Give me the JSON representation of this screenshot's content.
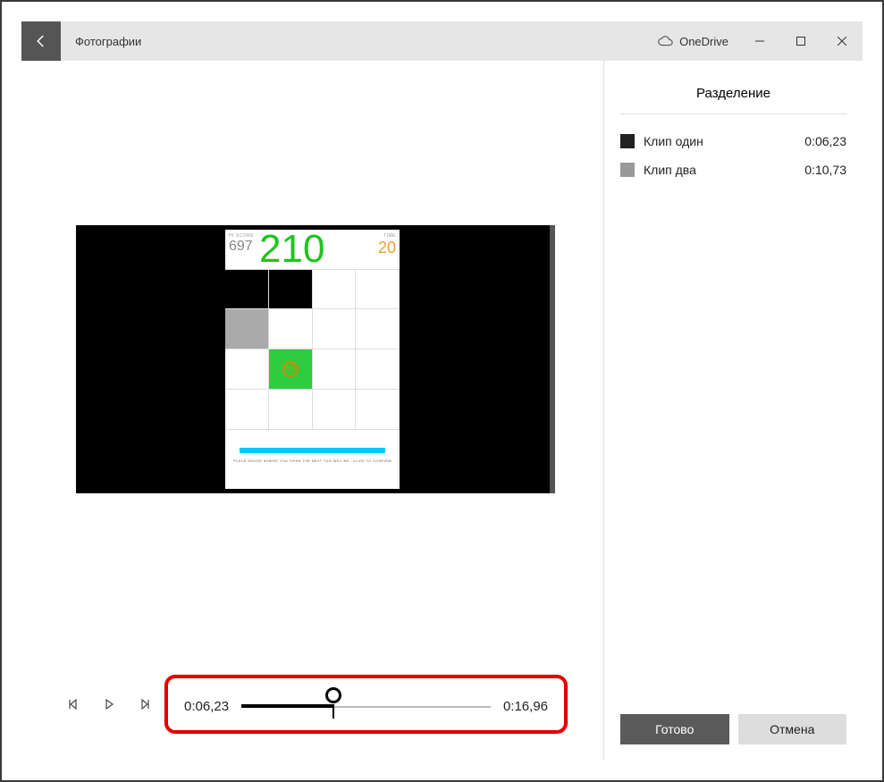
{
  "titlebar": {
    "app_name": "Фотографии",
    "onedrive_label": "OneDrive"
  },
  "video_frame": {
    "hiscore_label": "HI SCORE",
    "hiscore_value": "697",
    "score_value": "210",
    "time_label": "TIME",
    "time_value": "20",
    "bonus_text": "+5",
    "footer_text": "PLACE MOUSE WHERE YOU THINK THE NEXT TILE WILL BE - CLICK TO CONFIRM"
  },
  "timeline": {
    "current_time": "0:06,23",
    "total_time": "0:16,96"
  },
  "sidebar": {
    "title": "Разделение",
    "clips": [
      {
        "name": "Клип один",
        "duration": "0:06,23"
      },
      {
        "name": "Клип два",
        "duration": "0:10,73"
      }
    ],
    "done_label": "Готово",
    "cancel_label": "Отмена"
  }
}
